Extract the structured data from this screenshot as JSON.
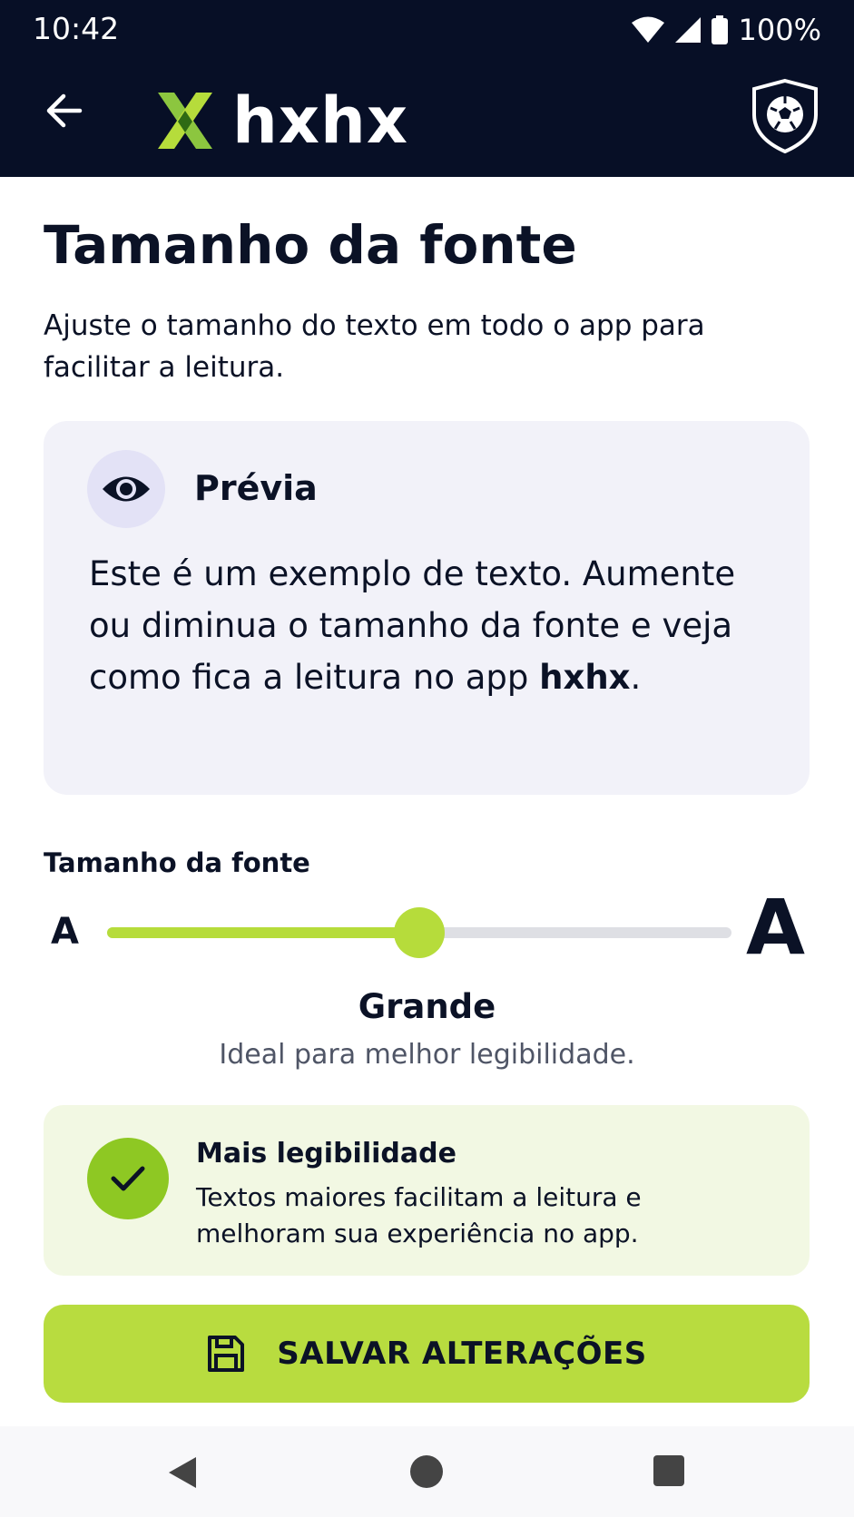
{
  "status_bar": {
    "time": "10:42",
    "battery": "100%"
  },
  "header": {
    "brand": "hxhx"
  },
  "page": {
    "title": "Tamanho da fonte",
    "subtitle": "Ajuste o tamanho do texto em todo o app para facilitar a leitura."
  },
  "preview": {
    "title": "Prévia",
    "text": "Este é um exemplo de texto. Aumente ou diminua o tamanho da fonte e veja como fica a leitura no app ",
    "text_bold": "hxhx",
    "text_end": "."
  },
  "slider": {
    "label": "Tamanho da fonte",
    "min_label": "A",
    "max_label": "A",
    "value_fraction": 0.5,
    "selected_name": "Grande",
    "selected_desc": "Ideal para melhor legibilidade."
  },
  "info": {
    "title": "Mais legibilidade",
    "text": "Textos maiores facilitam a leitura e melhoram sua experiência no app."
  },
  "save_button": {
    "label": "SALVAR ALTERAÇÕES"
  },
  "colors": {
    "header_bg": "#070f26",
    "accent": "#b8dc3f",
    "check": "#8ec823"
  },
  "icons": {
    "back": "arrow-left-icon",
    "shield": "soccer-shield-icon",
    "preview": "eye-icon",
    "info": "check-icon",
    "save": "floppy-disk-icon"
  }
}
